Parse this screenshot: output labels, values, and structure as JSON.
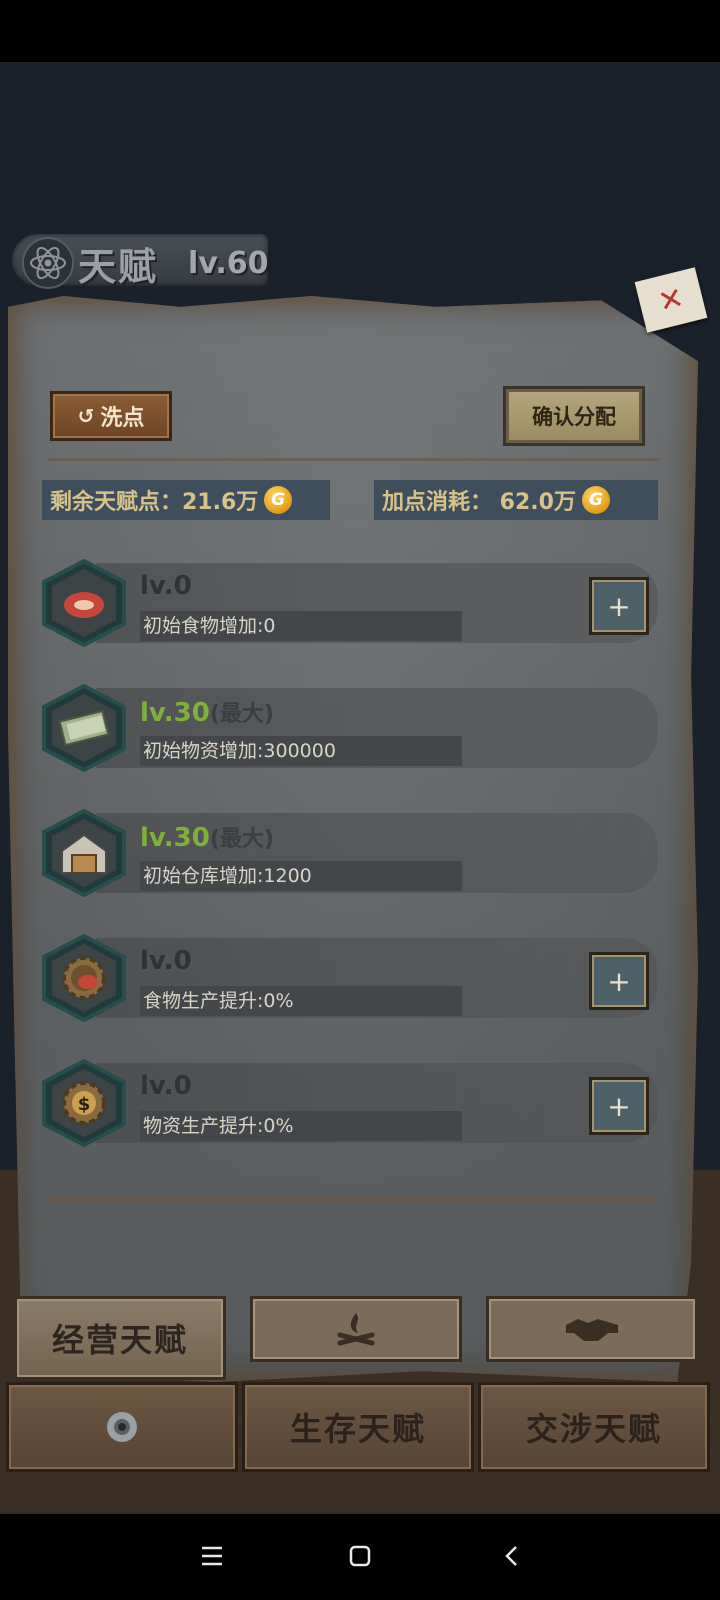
{
  "header": {
    "title": "天赋",
    "level": "lv.60"
  },
  "actions": {
    "reset_label": "洗点",
    "confirm_label": "确认分配"
  },
  "points": {
    "remaining_label": "剩余天赋点：21.6万",
    "cost_label": "加点消耗： 62.0万",
    "coin_glyph": "G"
  },
  "talents": [
    {
      "icon": "steak-icon",
      "level": "lv.0",
      "max_suffix": "",
      "desc": "初始食物增加:0",
      "upgradable": true
    },
    {
      "icon": "cash-stack-icon",
      "level": "lv.30",
      "max_suffix": "(最大)",
      "desc": "初始物资增加:300000",
      "upgradable": false
    },
    {
      "icon": "warehouse-icon",
      "level": "lv.30",
      "max_suffix": "(最大)",
      "desc": "初始仓库增加:1200",
      "upgradable": false
    },
    {
      "icon": "gear-steak-icon",
      "level": "lv.0",
      "max_suffix": "",
      "desc": "食物生产提升:0%",
      "upgradable": true
    },
    {
      "icon": "gear-dollar-icon",
      "level": "lv.0",
      "max_suffix": "",
      "desc": "物资生产提升:0%",
      "upgradable": true
    }
  ],
  "plus_glyph": "+",
  "tabs": {
    "active": "经营天赋",
    "survival": "生存天赋",
    "negotiation": "交涉天赋"
  },
  "colors": {
    "max_level": "#7fb03a",
    "gold": "#d7c38a",
    "background": "#1b212b"
  }
}
